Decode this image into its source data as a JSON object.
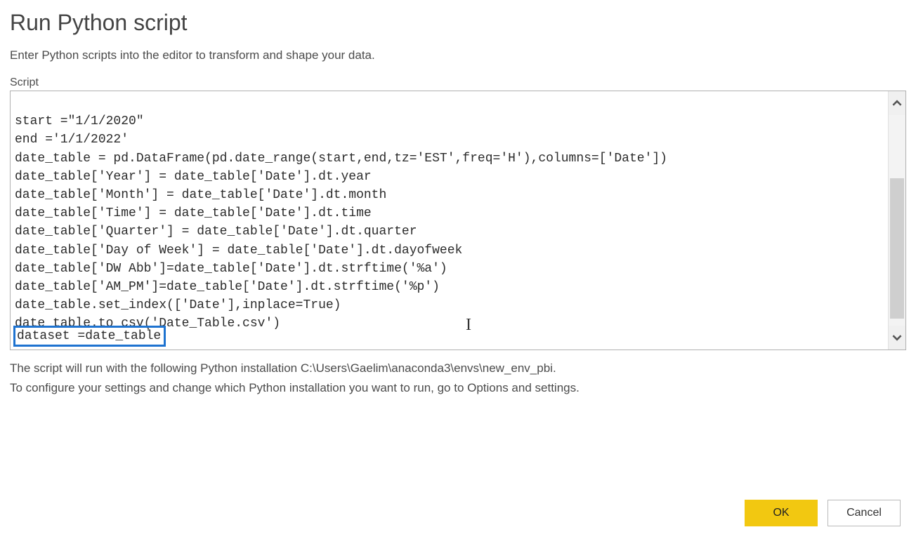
{
  "dialog": {
    "title": "Run Python script",
    "subtitle": "Enter Python scripts into the editor to transform and shape your data.",
    "script_label": "Script",
    "code_lines": [
      "start =\"1/1/2020\"",
      "end ='1/1/2022'",
      "date_table = pd.DataFrame(pd.date_range(start,end,tz='EST',freq='H'),columns=['Date'])",
      "date_table['Year'] = date_table['Date'].dt.year",
      "date_table['Month'] = date_table['Date'].dt.month",
      "date_table['Time'] = date_table['Date'].dt.time",
      "date_table['Quarter'] = date_table['Date'].dt.quarter",
      "date_table['Day of Week'] = date_table['Date'].dt.dayofweek",
      "date_table['DW Abb']=date_table['Date'].dt.strftime('%a')",
      "date_table['AM_PM']=date_table['Date'].dt.strftime('%p')",
      "date_table.set_index(['Date'],inplace=True)",
      "date_table.to_csv('Date_Table.csv')"
    ],
    "highlighted_line": "dataset =date_table",
    "info1": "The script will run with the following Python installation C:\\Users\\Gaelim\\anaconda3\\envs\\new_env_pbi.",
    "info2": "To configure your settings and change which Python installation you want to run, go to Options and settings.",
    "ok_label": "OK",
    "cancel_label": "Cancel"
  }
}
